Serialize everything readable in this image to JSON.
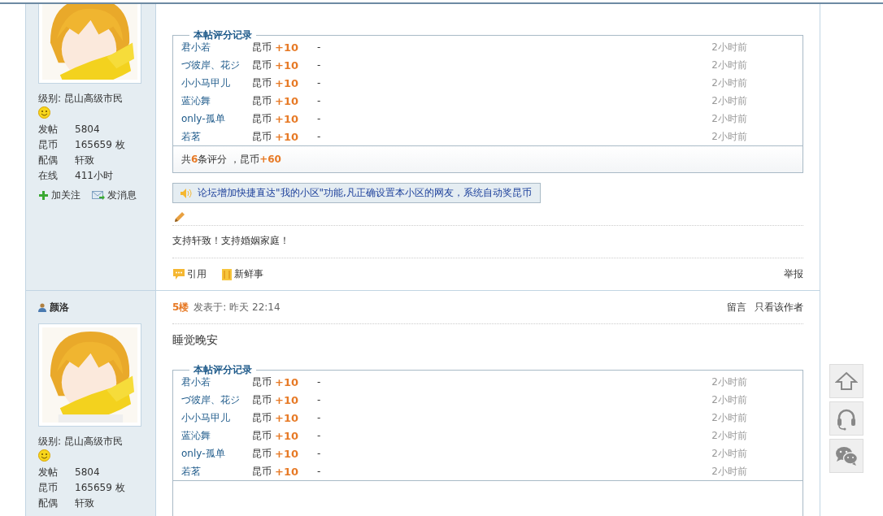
{
  "posts": [
    {
      "level_label": "级别:",
      "level": "昆山高级市民",
      "stats": [
        {
          "label": "发帖",
          "value": "5804"
        },
        {
          "label": "昆币",
          "value": "165659 枚"
        },
        {
          "label": "配偶",
          "value": "轩致"
        },
        {
          "label": "在线",
          "value": "411小时"
        }
      ],
      "profile_actions": [
        {
          "kind": "follow",
          "label": "加关注"
        },
        {
          "kind": "message",
          "label": "发消息"
        }
      ],
      "ratings": {
        "legend": "本帖评分记录",
        "rows": [
          {
            "user": "君小若",
            "currency": "昆币",
            "amount": "+10",
            "reason": "-",
            "time": "2小时前"
          },
          {
            "user": "づ彼岸、花ジ",
            "currency": "昆币",
            "amount": "+10",
            "reason": "-",
            "time": "2小时前"
          },
          {
            "user": "小小马甲儿",
            "currency": "昆币",
            "amount": "+10",
            "reason": "-",
            "time": "2小时前"
          },
          {
            "user": "蓝沁舞",
            "currency": "昆币",
            "amount": "+10",
            "reason": "-",
            "time": "2小时前"
          },
          {
            "user": "only-孤单",
            "currency": "昆币",
            "amount": "+10",
            "reason": "-",
            "time": "2小时前"
          },
          {
            "user": "若茗",
            "currency": "昆币",
            "amount": "+10",
            "reason": "-",
            "time": "2小时前"
          }
        ],
        "summary": "共**6**条评分 ，昆币**+60**"
      },
      "notice": "论坛增加快捷直达\"我的小区\"功能,凡正确设置本小区的网友，系统自动奖昆币",
      "signature": "支持轩致！支持婚姻家庭！",
      "post_actions": [
        {
          "kind": "quote",
          "label": "引用"
        },
        {
          "kind": "news",
          "label": "新鲜事"
        }
      ],
      "report": "举报"
    },
    {
      "floor": "5楼",
      "posted": "发表于: 昨天 22:14",
      "header_links": [
        "留言",
        "只看该作者"
      ],
      "author": "颜洛",
      "level_label": "级别:",
      "level": "昆山高级市民",
      "stats": [
        {
          "label": "发帖",
          "value": "5804"
        },
        {
          "label": "昆币",
          "value": "165659 枚"
        },
        {
          "label": "配偶",
          "value": "轩致"
        }
      ],
      "body": "睡觉晚安",
      "ratings": {
        "legend": "本帖评分记录",
        "rows": [
          {
            "user": "君小若",
            "currency": "昆币",
            "amount": "+10",
            "reason": "-",
            "time": "2小时前"
          },
          {
            "user": "づ彼岸、花ジ",
            "currency": "昆币",
            "amount": "+10",
            "reason": "-",
            "time": "2小时前"
          },
          {
            "user": "小小马甲儿",
            "currency": "昆币",
            "amount": "+10",
            "reason": "-",
            "time": "2小时前"
          },
          {
            "user": "蓝沁舞",
            "currency": "昆币",
            "amount": "+10",
            "reason": "-",
            "time": "2小时前"
          },
          {
            "user": "only-孤单",
            "currency": "昆币",
            "amount": "+10",
            "reason": "-",
            "time": "2小时前"
          },
          {
            "user": "若茗",
            "currency": "昆币",
            "amount": "+10",
            "reason": "-",
            "time": "2小时前"
          }
        ]
      }
    }
  ],
  "side_tools": [
    {
      "kind": "top"
    },
    {
      "kind": "headset"
    },
    {
      "kind": "wechat"
    }
  ]
}
